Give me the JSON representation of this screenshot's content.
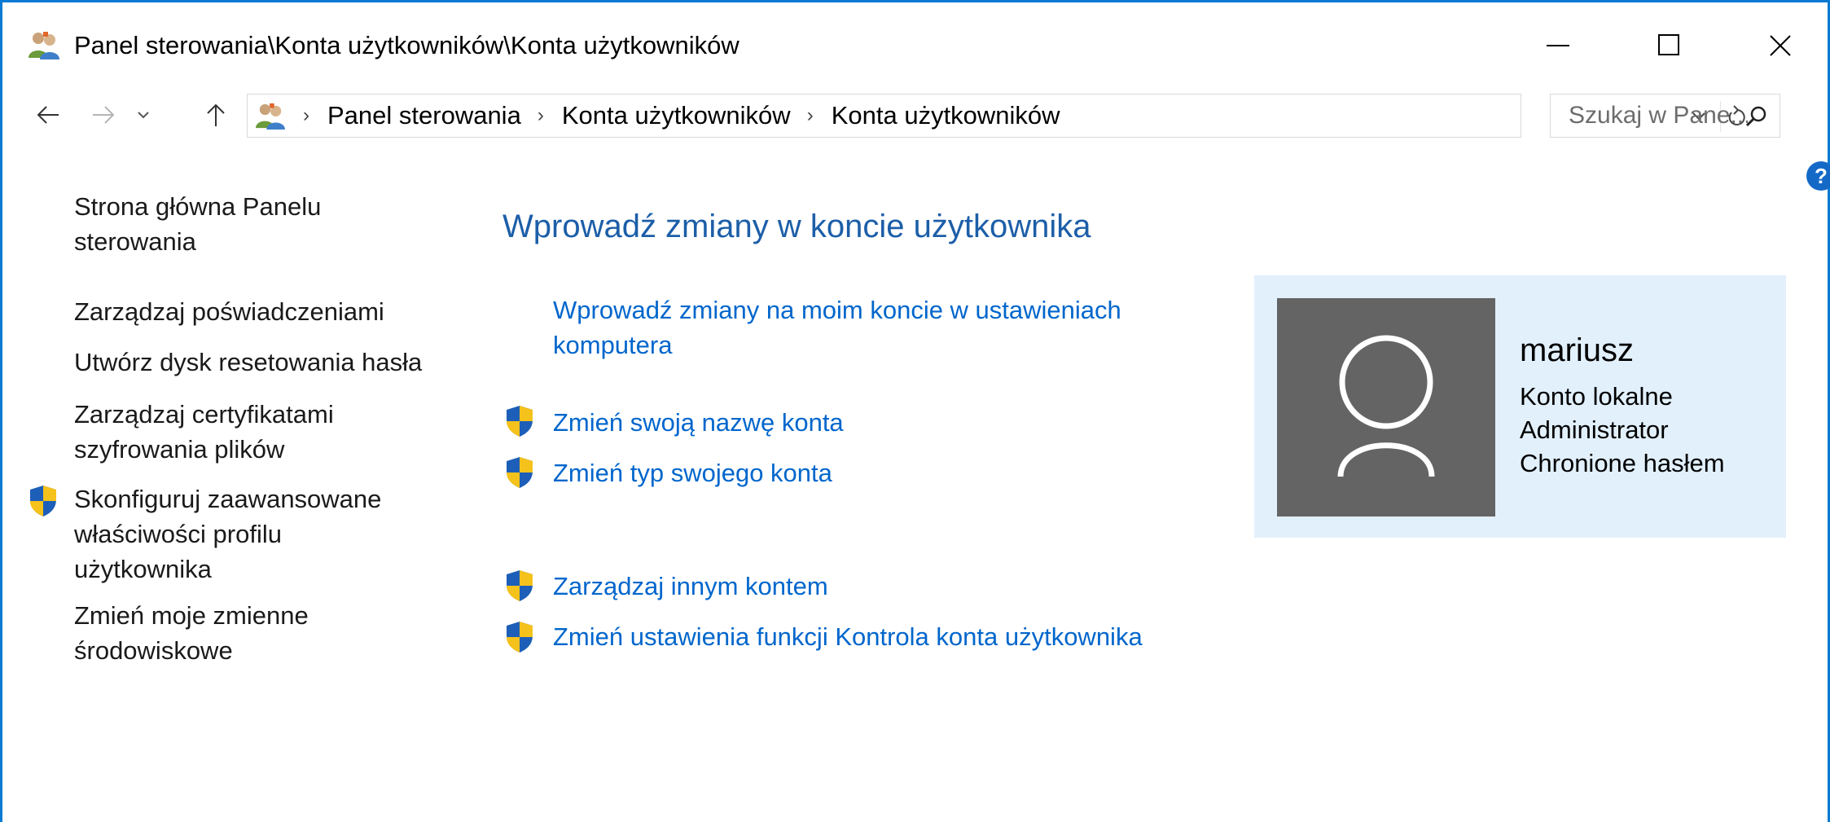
{
  "window": {
    "title": "Panel sterowania\\Konta użytkowników\\Konta użytkowników"
  },
  "nav": {
    "breadcrumbs": [
      "Panel sterowania",
      "Konta użytkowników",
      "Konta użytkowników"
    ],
    "search_placeholder": "Szukaj w Pane..."
  },
  "left_pane": {
    "home_link": [
      "Strona główna Panelu",
      "sterowania"
    ],
    "manage_credentials": "Zarządzaj poświadczeniami",
    "create_reset_disk": "Utwórz dysk resetowania hasła",
    "manage_certificates": [
      "Zarządzaj certyfikatami",
      "szyfrowania plików"
    ],
    "configure_profile": [
      "Skonfiguruj zaawansowane",
      "właściwości profilu",
      "użytkownika"
    ],
    "change_env_vars": [
      "Zmień moje zmienne",
      "środowiskowe"
    ]
  },
  "main": {
    "heading": "Wprowadź zmiany w koncie użytkownika",
    "pc_settings_link": [
      "Wprowadź zmiany na moim koncie w ustawieniach",
      "komputera"
    ],
    "change_name": "Zmień swoją nazwę konta",
    "change_type": "Zmień typ swojego konta",
    "manage_other": "Zarządzaj innym kontem",
    "uac_settings": "Zmień ustawienia funkcji Kontrola konta użytkownika"
  },
  "user": {
    "name": "mariusz",
    "account_type": "Konto lokalne",
    "role": "Administrator",
    "password_status": "Chronione hasłem"
  },
  "colors": {
    "accent_border": "#0a7bd4",
    "link": "#0066cc",
    "heading": "#1c5ea8",
    "card_background": "#e2f0fc",
    "avatar_background": "#646464"
  }
}
